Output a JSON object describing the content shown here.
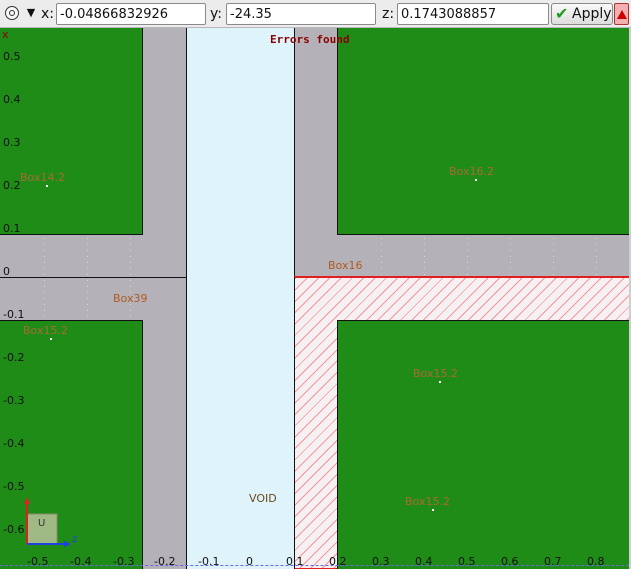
{
  "toolbar": {
    "view_icon": "target-icon",
    "dropdown_icon": "chevron-down-icon",
    "x_label": "x:",
    "x_value": "-0.04866832926",
    "y_label": "y:",
    "y_value": "-24.35",
    "z_label": "z:",
    "z_value": "0.1743088857",
    "apply_label": "Apply",
    "apply_icon": "checkmark-icon",
    "warning_icon": "warning-triangle-icon"
  },
  "viewport": {
    "banner": "Errors found",
    "axis_letter": "x",
    "regions": [
      {
        "name": "Box14.2",
        "style": "muted"
      },
      {
        "name": "Box16.2",
        "style": "muted"
      },
      {
        "name": "Box16",
        "style": "normal"
      },
      {
        "name": "Box39",
        "style": "normal"
      },
      {
        "name": "Box15.2",
        "style": "muted"
      },
      {
        "name": "Box15.2",
        "style": "muted"
      },
      {
        "name": "Box15.2",
        "style": "muted"
      },
      {
        "name": "VOID",
        "style": "void"
      }
    ],
    "y_ticks": [
      "0.5",
      "0.4",
      "0.3",
      "0.2",
      "0.1",
      "0",
      "-0.1",
      "-0.2",
      "-0.3",
      "-0.4",
      "-0.5",
      "-0.6"
    ],
    "x_ticks": [
      "-0.5",
      "-0.4",
      "-0.3",
      "-0.2",
      "-0.1",
      "0",
      "0.1",
      "0.2",
      "0.3",
      "0.4",
      "0.5",
      "0.6",
      "0.7",
      "0.8"
    ],
    "axis_widget": {
      "up_label": "",
      "right_label": "z",
      "box_label": "U"
    },
    "colors": {
      "material": "#208c18",
      "gap": "#b4b2b8",
      "void": "#dff3fb",
      "error": "#e02020",
      "label": "#b05a20"
    }
  }
}
